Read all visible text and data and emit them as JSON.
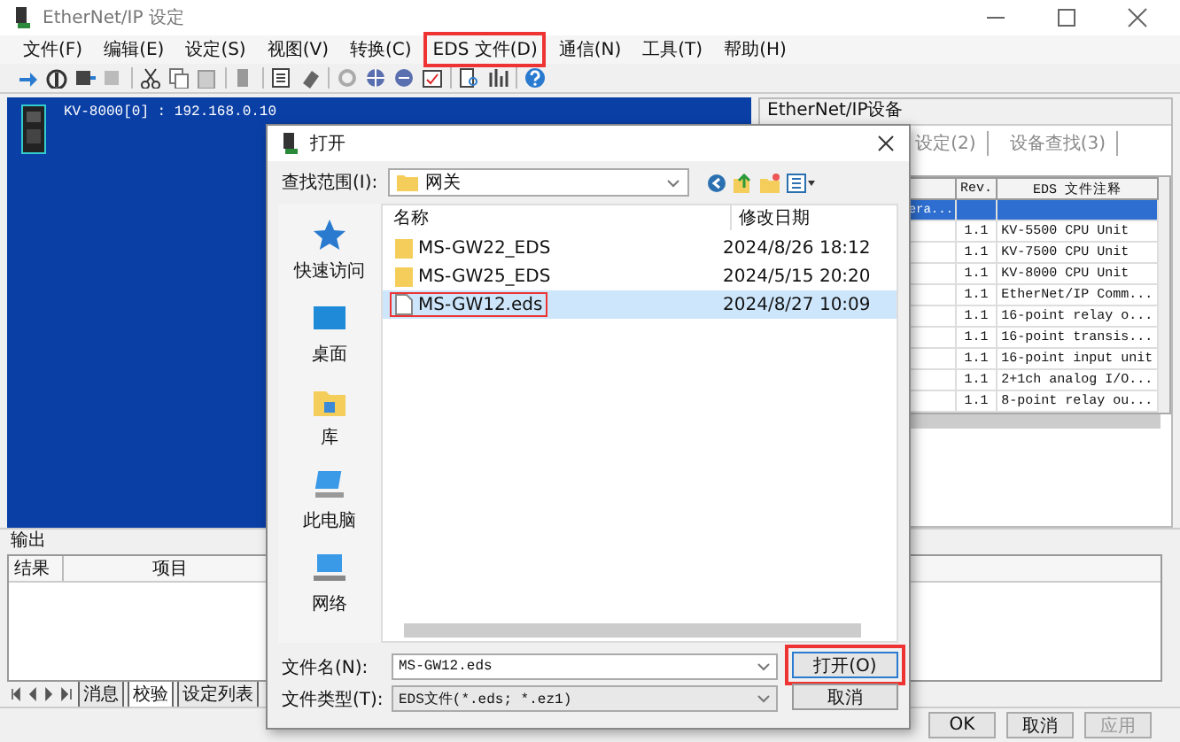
{
  "window": {
    "title": "EtherNet/IP 设定"
  },
  "menu": [
    {
      "label": "文件(F)",
      "highlighted": false
    },
    {
      "label": "编辑(E)",
      "highlighted": false
    },
    {
      "label": "设定(S)",
      "highlighted": false
    },
    {
      "label": "视图(V)",
      "highlighted": false
    },
    {
      "label": "转换(C)",
      "highlighted": false
    },
    {
      "label": "EDS 文件(D)",
      "highlighted": true
    },
    {
      "label": "通信(N)",
      "highlighted": false
    },
    {
      "label": "工具(T)",
      "highlighted": false
    },
    {
      "label": "帮助(H)",
      "highlighted": false
    }
  ],
  "device_view": {
    "label": "KV-8000[0] : 192.168.0.10"
  },
  "device_panel": {
    "title": "EtherNet/IP设备",
    "tabs": [
      {
        "label": "设定(2)",
        "selected": false
      },
      {
        "label": "设备查找(3)",
        "selected": false
      }
    ],
    "columns": [
      "Rev.",
      "EDS 文件注释"
    ],
    "rows": [
      {
        "column_1": "era...",
        "cells": [],
        "selected": true
      },
      {
        "cells": [
          "1.1",
          "KV-5500 CPU Unit"
        ],
        "selected": false
      },
      {
        "cells": [
          "1.1",
          "KV-7500 CPU Unit"
        ],
        "selected": false
      },
      {
        "cells": [
          "1.1",
          "KV-8000 CPU Unit"
        ],
        "selected": false
      },
      {
        "cells": [
          "1.1",
          "EtherNet/IP Comm..."
        ],
        "selected": false
      },
      {
        "cells": [
          "1.1",
          "16-point relay o..."
        ],
        "selected": false
      },
      {
        "cells": [
          "1.1",
          "16-point transis..."
        ],
        "selected": false
      },
      {
        "cells": [
          "1.1",
          "16-point input unit"
        ],
        "selected": false
      },
      {
        "cells": [
          "1.1",
          "2+1ch analog I/O..."
        ],
        "selected": false
      },
      {
        "cells": [
          "1.1",
          "8-point relay ou..."
        ],
        "selected": false
      }
    ]
  },
  "output": {
    "title": "输出",
    "columns": [
      "结果",
      "项目"
    ],
    "tabs": [
      {
        "label": "消息",
        "selected": false
      },
      {
        "label": "校验",
        "selected": true
      },
      {
        "label": "设定列表",
        "selected": false
      }
    ]
  },
  "buttons": [
    {
      "label": "OK",
      "disabled": false
    },
    {
      "label": "取消",
      "disabled": false
    },
    {
      "label": "应用",
      "disabled": true
    }
  ],
  "dialog": {
    "title": "打开",
    "look_in_label": "查找范围(I):",
    "look_in": "网关",
    "places": [
      {
        "label": "快速访问",
        "kind": "star"
      },
      {
        "label": "桌面",
        "kind": "desktop"
      },
      {
        "label": "库",
        "kind": "library"
      },
      {
        "label": "此电脑",
        "kind": "computer"
      },
      {
        "label": "网络",
        "kind": "network"
      }
    ],
    "columns": [
      "名称",
      "修改日期"
    ],
    "files": [
      {
        "name": "MS-GW22_EDS",
        "date": "2024/8/26 18:12",
        "kind": "folder",
        "selected": false,
        "highlighted": false
      },
      {
        "name": "MS-GW25_EDS",
        "date": "2024/5/15 20:20",
        "kind": "folder",
        "selected": false,
        "highlighted": false
      },
      {
        "name": "MS-GW12.eds",
        "date": "2024/8/27 10:09",
        "kind": "file",
        "selected": true,
        "highlighted": true
      }
    ],
    "filename_label": "文件名(N):",
    "filename": "MS-GW12.eds",
    "filetype_label": "文件类型(T):",
    "filetype": "EDS文件(*.eds; *.ez1)",
    "buttons": [
      {
        "label": "打开(O)",
        "highlighted": true
      },
      {
        "label": "取消",
        "highlighted": false
      }
    ]
  }
}
